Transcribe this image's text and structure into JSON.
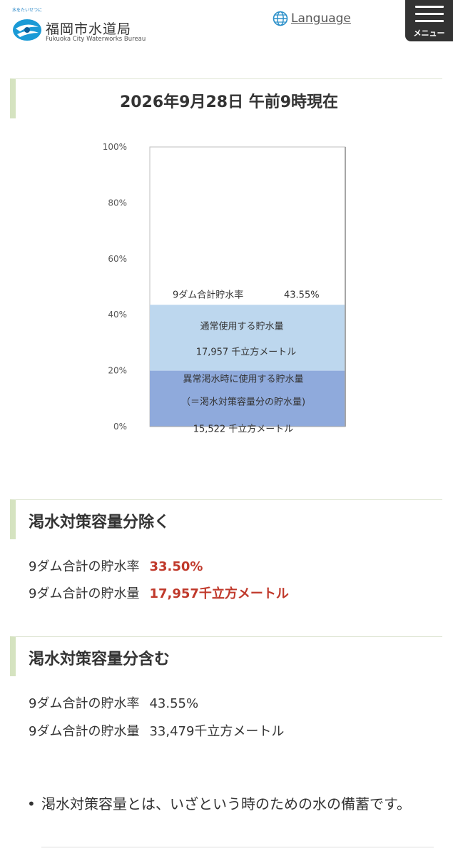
{
  "header": {
    "logo_tagline": "水をたいせつに",
    "logo_title": "福岡市水道局",
    "logo_subtitle": "Fukuoka City Waterworks Bureau",
    "language_label": "Language",
    "menu_label": "メニュー"
  },
  "status": {
    "date_heading": "2026年9月28日 午前9時現在"
  },
  "chart_data": {
    "type": "bar",
    "ylim": [
      0,
      100
    ],
    "y_ticks": [
      "0%",
      "20%",
      "40%",
      "60%",
      "80%",
      "100%"
    ],
    "total_label": "9ダム合計貯水率",
    "total_value": "43.55%",
    "total_percent": 43.55,
    "segments": [
      {
        "name": "異常渇水時に使用する貯水量",
        "sub": "（＝渇水対策容量分の貯水量)",
        "amount": "15,522 千立方メートル",
        "percent": 20,
        "color": "#8faadc"
      },
      {
        "name": "通常使用する貯水量",
        "amount": "17,957 千立方メートル",
        "percent": 23.55,
        "color": "#bdd7ee"
      }
    ]
  },
  "excluding": {
    "title": "渇水対策容量分除く",
    "rate_label": "9ダム合計の貯水率",
    "rate_value": "33.50%",
    "volume_label": "9ダム合計の貯水量",
    "volume_value": "17,957千立方メートル"
  },
  "including": {
    "title": "渇水対策容量分含む",
    "rate_label": "9ダム合計の貯水率",
    "rate_value": "43.55%",
    "volume_label": "9ダム合計の貯水量",
    "volume_value": "33,479千立方メートル"
  },
  "notes": [
    "渇水対策容量とは、いざという時のための水の備蓄です。"
  ]
}
